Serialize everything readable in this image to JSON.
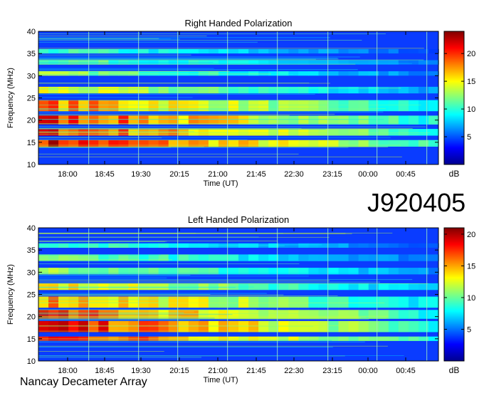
{
  "header": {
    "observation_code": "J920405"
  },
  "footer": {
    "instrument": "Nancay Decameter Array"
  },
  "chart_data": [
    {
      "type": "heatmap",
      "title": "Right Handed Polarization",
      "xlabel": "Time (UT)",
      "ylabel": "Frequency (MHz)",
      "x_ticks": [
        "18:00",
        "18:45",
        "19:30",
        "20:15",
        "21:00",
        "21:45",
        "22:30",
        "23:15",
        "00:00",
        "00:45"
      ],
      "y_ticks": [
        10,
        15,
        20,
        25,
        30,
        35,
        40
      ],
      "ylim": [
        10,
        40
      ],
      "colorbar": {
        "label": "dB",
        "range": [
          0,
          24
        ],
        "ticks": [
          5,
          10,
          15,
          20
        ]
      },
      "emission_bands_mhz": [
        {
          "from": 14,
          "to": 15.5,
          "level_db": 22
        },
        {
          "from": 16.5,
          "to": 18,
          "level_db": 21
        },
        {
          "from": 19,
          "to": 21,
          "level_db": 21
        },
        {
          "from": 22,
          "to": 24.5,
          "level_db": 19
        },
        {
          "from": 26,
          "to": 27.5,
          "level_db": 15
        },
        {
          "from": 30,
          "to": 31,
          "level_db": 13
        },
        {
          "from": 32.5,
          "to": 33.5,
          "level_db": 12
        },
        {
          "from": 35,
          "to": 36,
          "level_db": 11
        }
      ]
    },
    {
      "type": "heatmap",
      "title": "Left Handed Polarization",
      "xlabel": "Time (UT)",
      "ylabel": "Frequency (MHz)",
      "x_ticks": [
        "18:00",
        "18:45",
        "19:30",
        "20:15",
        "21:00",
        "21:45",
        "22:30",
        "23:15",
        "00:00",
        "00:45"
      ],
      "y_ticks": [
        10,
        15,
        20,
        25,
        30,
        35,
        40
      ],
      "ylim": [
        10,
        40
      ],
      "colorbar": {
        "label": "dB",
        "range": [
          0,
          21
        ],
        "ticks": [
          5,
          10,
          15,
          20
        ]
      },
      "emission_bands_mhz": [
        {
          "from": 14.5,
          "to": 15.5,
          "level_db": 19
        },
        {
          "from": 16.5,
          "to": 19,
          "level_db": 19
        },
        {
          "from": 19.5,
          "to": 21.5,
          "level_db": 18
        },
        {
          "from": 22,
          "to": 24.5,
          "level_db": 16
        },
        {
          "from": 26,
          "to": 27.5,
          "level_db": 14
        },
        {
          "from": 29.5,
          "to": 31,
          "level_db": 12
        },
        {
          "from": 32.5,
          "to": 34,
          "level_db": 11
        },
        {
          "from": 35.5,
          "to": 36.5,
          "level_db": 10
        }
      ]
    }
  ]
}
